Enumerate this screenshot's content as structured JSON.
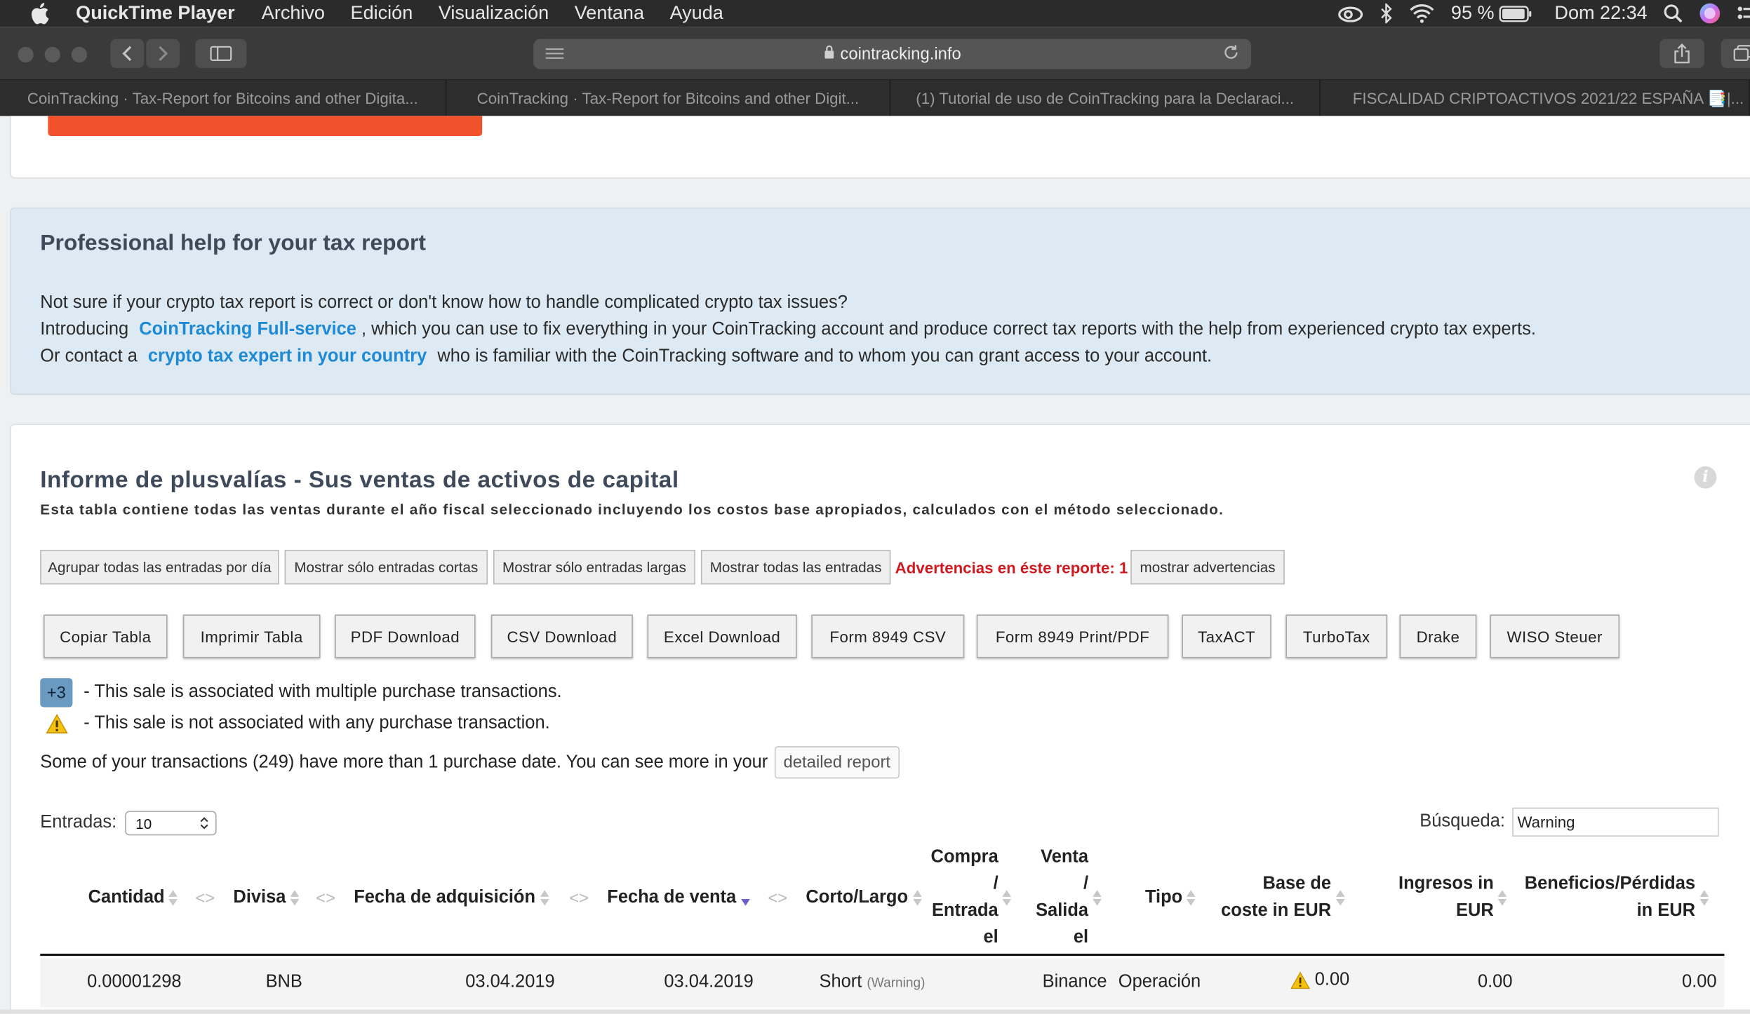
{
  "menubar": {
    "app_name": "QuickTime Player",
    "items": [
      "Archivo",
      "Edición",
      "Visualización",
      "Ventana",
      "Ayuda"
    ],
    "battery": "95 %",
    "clock": "Dom 22:34"
  },
  "browser": {
    "url": "cointracking.info",
    "tabs": [
      "CoinTracking · Tax-Report for Bitcoins and other Digita...",
      "CoinTracking · Tax-Report for Bitcoins and other Digit...",
      "(1) Tutorial de uso de CoinTracking para la Declaraci...",
      "FISCALIDAD CRIPTOACTIVOS 2021/22 ESPAÑA 📑|..."
    ]
  },
  "help": {
    "title": "Professional help for your tax report",
    "line1": "Not sure if your crypto tax report is correct or don't know how to handle complicated crypto tax issues?",
    "line2_pre": "Introducing ",
    "line2_link": "CoinTracking Full-service",
    "line2_post": " , which you can use to fix everything in your CoinTracking account and produce correct tax reports with the help from experienced crypto tax experts.",
    "line3_pre": "Or contact a ",
    "line3_link": "crypto tax expert in your country",
    "line3_post": " who is familiar with the CoinTracking software and to whom you can grant access to your account."
  },
  "report": {
    "title": "Informe de plusvalías - Sus ventas de activos de capital",
    "subtitle": "Esta tabla contiene todas las ventas durante el año fiscal seleccionado incluyendo los costos base apropiados, calculados con el método seleccionado.",
    "filter_buttons": [
      "Agrupar todas las entradas por día",
      "Mostrar sólo entradas cortas",
      "Mostrar sólo entradas largas",
      "Mostrar todas las entradas"
    ],
    "warnings_text": "Advertencias en éste reporte: 1",
    "show_warnings": "mostrar advertencias",
    "export_buttons": [
      "Copiar Tabla",
      "Imprimir Tabla",
      "PDF Download",
      "CSV Download",
      "Excel Download",
      "Form 8949 CSV",
      "Form 8949 Print/PDF",
      "TaxACT",
      "TurboTax",
      "Drake",
      "WISO Steuer"
    ],
    "legend_badge": "+3",
    "legend_multi": "- This sale is associated with multiple purchase transactions.",
    "legend_none": "- This sale is not associated with any purchase transaction.",
    "multi_date_text": "Some of your transactions (249) have more than 1 purchase date. You can see more in your",
    "detailed_report": "detailed report",
    "entries_label": "Entradas:",
    "entries_value": "10",
    "search_label": "Búsqueda:",
    "search_value": "Warning",
    "columns": {
      "cantidad": "Cantidad",
      "divisa": "Divisa",
      "fecha_adq": "Fecha de adquisición",
      "fecha_venta": "Fecha de venta",
      "corto_largo": "Corto/Largo",
      "compra": [
        "Compra",
        "/",
        "Entrada",
        "el"
      ],
      "venta": [
        "Venta",
        "/",
        "Salida",
        "el"
      ],
      "tipo": "Tipo",
      "base": [
        "Base de",
        "coste in EUR"
      ],
      "ingresos": [
        "Ingresos in",
        "EUR"
      ],
      "beneficios": [
        "Beneficios/Pérdidas",
        "in EUR"
      ]
    },
    "rows": [
      {
        "cantidad": "0.00001298",
        "divisa": "BNB",
        "fecha_adq": "03.04.2019",
        "fecha_venta": "03.04.2019",
        "corto_largo": "Short",
        "corto_largo_note": "(Warning)",
        "compra": "",
        "venta": "Binance",
        "tipo": "Operación",
        "base": "0.00",
        "ingresos": "0.00",
        "beneficios": "0.00"
      }
    ]
  }
}
